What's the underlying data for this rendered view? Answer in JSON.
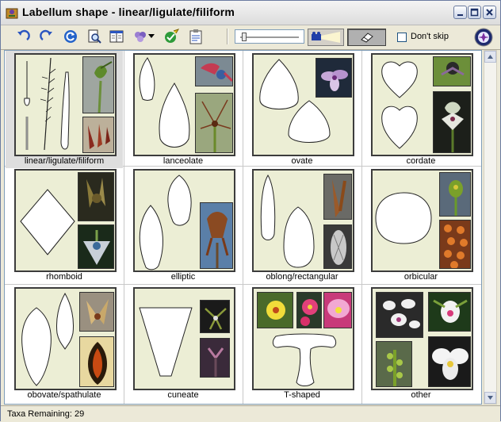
{
  "window": {
    "title": "Labellum shape - linear/ligulate/filiform",
    "icons": [
      "app-icon",
      "minimize-icon",
      "maximize-icon",
      "close-icon"
    ]
  },
  "toolbar": {
    "buttons": [
      "undo-icon",
      "redo-icon",
      "refresh-icon",
      "preview-document-icon",
      "view-compare-icon",
      "group-icon",
      "dropdown-arrow-icon",
      "check-edit-icon",
      "notes-clipboard-icon",
      "camera-projector-icon",
      "eraser-icon",
      "orchid-logo-icon"
    ],
    "dont_skip_label": "Don't skip",
    "dont_skip_checked": false
  },
  "shapes": [
    {
      "label": "linear/ligulate/filiform",
      "selected": true
    },
    {
      "label": "lanceolate",
      "selected": false
    },
    {
      "label": "ovate",
      "selected": false
    },
    {
      "label": "cordate",
      "selected": false
    },
    {
      "label": "rhomboid",
      "selected": false
    },
    {
      "label": "elliptic",
      "selected": false
    },
    {
      "label": "oblong/rectangular",
      "selected": false
    },
    {
      "label": "orbicular",
      "selected": false
    },
    {
      "label": "obovate/spathulate",
      "selected": false
    },
    {
      "label": "cuneate",
      "selected": false
    },
    {
      "label": "T-shaped",
      "selected": false
    },
    {
      "label": "other",
      "selected": false
    }
  ],
  "status": {
    "text": "Taxa Remaining: 29"
  },
  "colors": {
    "card_background": "#eceed5",
    "selected_cell": "#dedede",
    "window_face": "#ece9d8"
  }
}
